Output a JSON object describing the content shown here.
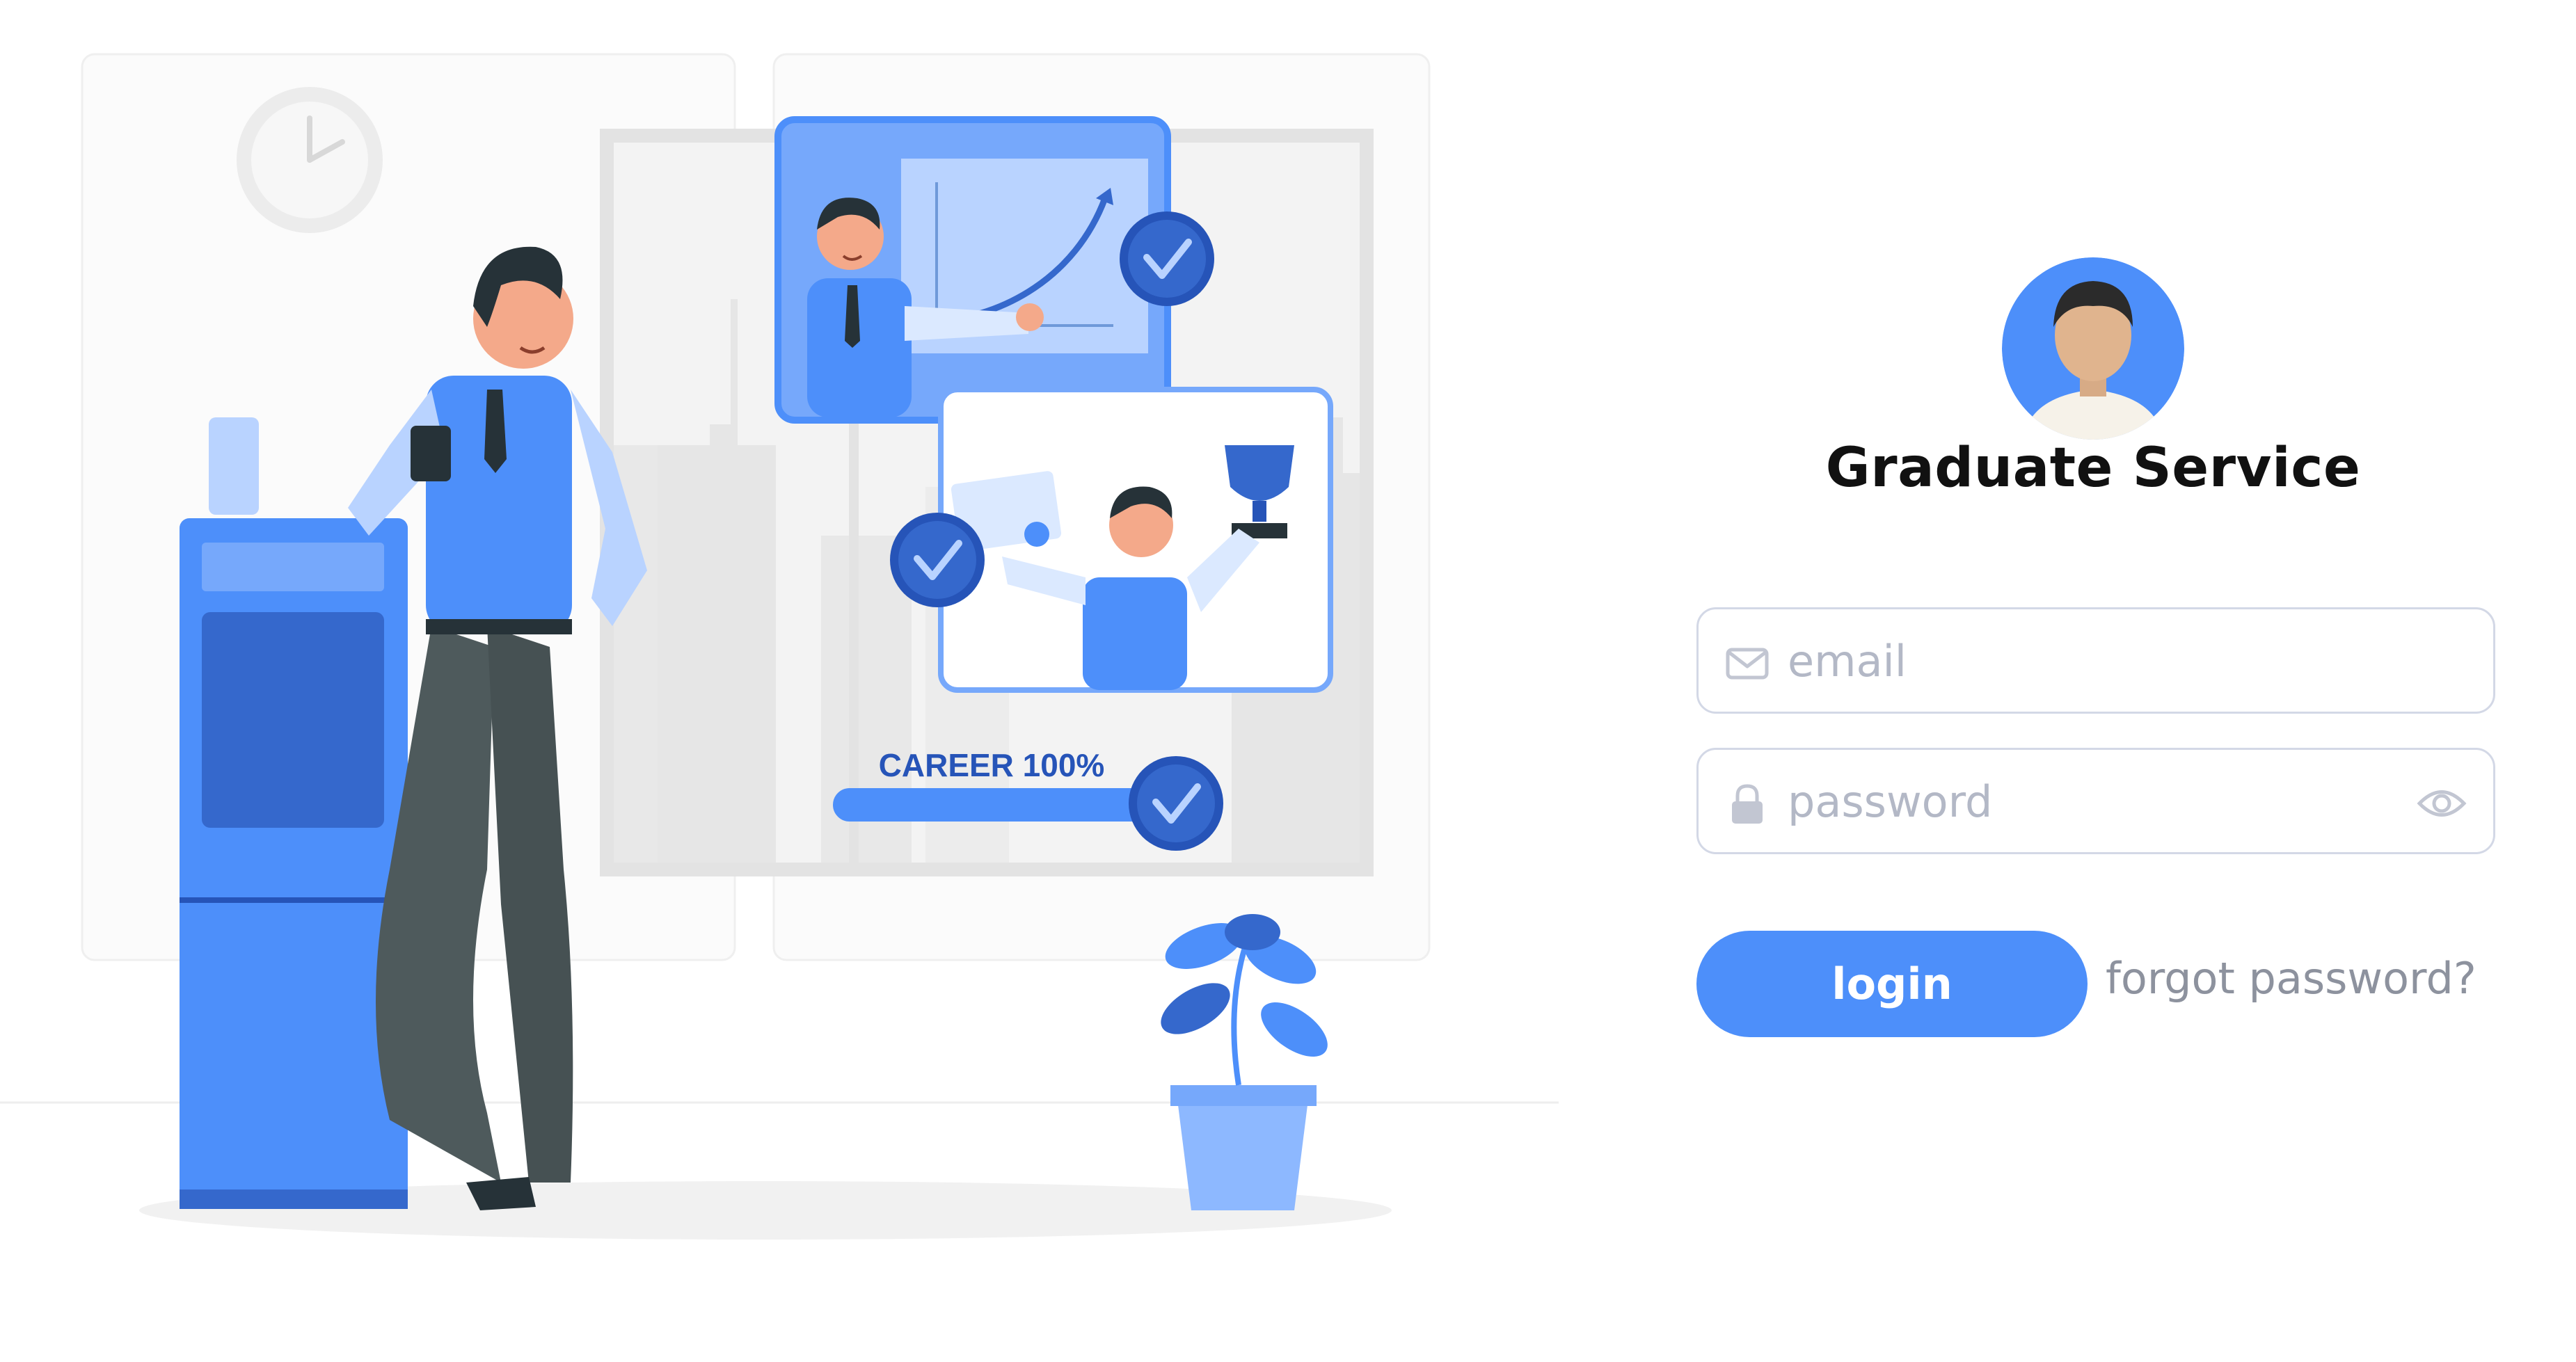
{
  "illustration": {
    "progress_label": "CAREER 100%",
    "progress_value": 1.0,
    "colors": {
      "primary": "#4d8ffa",
      "primary_dark": "#2654b8",
      "primary_light": "#b9d3ff",
      "panel_bg": "#f4f4f4",
      "city_gray": "#e0e0e0",
      "trousers": "#4e5a5c",
      "hair": "#263238",
      "skin": "#f4a98a"
    }
  },
  "login": {
    "title": "Graduate Service",
    "email_placeholder": "email",
    "password_placeholder": "password",
    "login_label": "login",
    "forgot_label": "forgot password?",
    "icons": {
      "avatar": "user-avatar-icon",
      "email": "envelope-icon",
      "password": "lock-icon",
      "toggle": "eye-icon"
    },
    "colors": {
      "accent": "#4d8ffa",
      "field_border": "#d3d8e6",
      "placeholder": "#b3b8c6",
      "link": "#8d929e"
    }
  }
}
